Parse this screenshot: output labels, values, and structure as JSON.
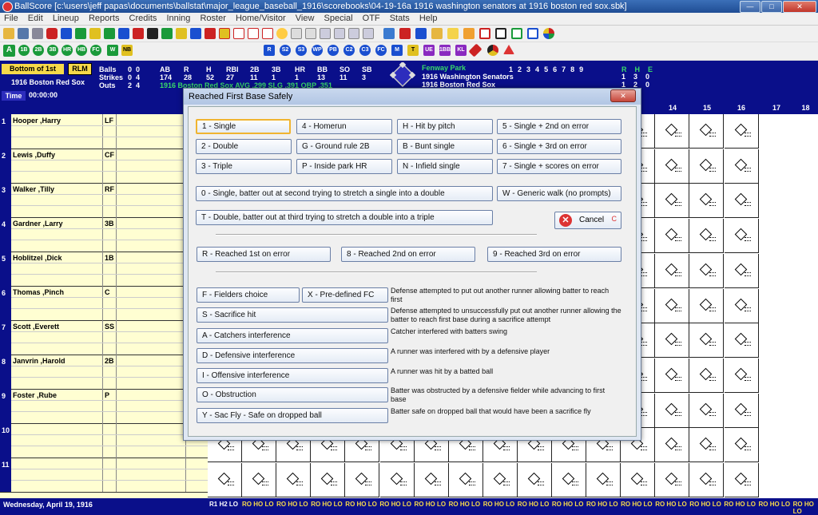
{
  "window": {
    "title": "BallScore   [c:\\users\\jeff papas\\documents\\ballstat\\major_league_baseball_1916\\scorebooks\\04-19-16a 1916 washington senators  at  1916 boston red sox.sbk]",
    "min": "—",
    "max": "□",
    "close": "✕"
  },
  "menu": [
    "File",
    "Edit",
    "Lineup",
    "Reports",
    "Credits",
    "Inning",
    "Roster",
    "Home/Visitor",
    "View",
    "Special",
    "OTF",
    "Stats",
    "Help"
  ],
  "toolbar2": [
    "A",
    "1B",
    "2B",
    "3B",
    "HR",
    "HB",
    "FC",
    "W",
    "NB",
    "R",
    "S2",
    "S3",
    "WP",
    "PB",
    "C2",
    "C3",
    "FC",
    "M",
    "T",
    "UE",
    "1BB",
    "KL"
  ],
  "scoreboard": {
    "inning": "Bottom of 1st",
    "rlm": "RLM",
    "team": "1916 Boston Red Sox",
    "time_label": "Time",
    "clock": "00:00:00",
    "counts": [
      {
        "label": "Balls",
        "a": "0",
        "b": "0"
      },
      {
        "label": "Strikes",
        "a": "0",
        "b": "4"
      },
      {
        "label": "Outs",
        "a": "2",
        "b": "4"
      }
    ],
    "stats_headers": [
      "AB",
      "R",
      "H",
      "RBI",
      "2B",
      "3B",
      "HR",
      "BB",
      "SO",
      "SB"
    ],
    "stats_values": [
      "174",
      "28",
      "52",
      "27",
      "11",
      "1",
      "1",
      "13",
      "11",
      "3"
    ],
    "stat_team_line": "1916 Boston Red Sox    AVG .299 SLG .391 OBP .351",
    "park": "Fenway Park",
    "line_teams": [
      "1916 Washington Senators",
      "1916 Boston Red Sox"
    ],
    "innings": [
      "1",
      "2",
      "3",
      "4",
      "5",
      "6",
      "7",
      "8",
      "9"
    ],
    "rhe_headers": [
      "R",
      "H",
      "E"
    ],
    "rhe": [
      [
        "1",
        "3",
        "0"
      ],
      [
        "1",
        "2",
        "0"
      ]
    ]
  },
  "columns": [
    "14",
    "15",
    "16",
    "17",
    "18"
  ],
  "lineup": [
    {
      "num": "1",
      "name": "Hooper ,Harry",
      "pos": "LF"
    },
    {
      "num": "2",
      "name": "Lewis ,Duffy",
      "pos": "CF"
    },
    {
      "num": "3",
      "name": "Walker ,Tilly",
      "pos": "RF"
    },
    {
      "num": "4",
      "name": "Gardner ,Larry",
      "pos": "3B"
    },
    {
      "num": "5",
      "name": "Hoblitzel ,Dick",
      "pos": "1B"
    },
    {
      "num": "6",
      "name": "Thomas ,Pinch",
      "pos": "C"
    },
    {
      "num": "7",
      "name": "Scott ,Everett",
      "pos": "SS"
    },
    {
      "num": "8",
      "name": "Janvrin ,Harold",
      "pos": "2B"
    },
    {
      "num": "9",
      "name": "Foster ,Rube",
      "pos": "P"
    },
    {
      "num": "10",
      "name": "",
      "pos": ""
    },
    {
      "num": "11",
      "name": "",
      "pos": ""
    }
  ],
  "footer": {
    "date": "Wednesday, April 19, 1916",
    "first": "R1 H2 LO",
    "rest": "RO HO LO"
  },
  "dialog": {
    "title": "Reached First Base Safely",
    "close": "✕",
    "hits": [
      "1 - Single",
      "4 - Homerun",
      "H - Hit by pitch",
      "5 - Single + 2nd on error",
      "2 - Double",
      "G - Ground rule 2B",
      "B - Bunt single",
      "6 - Single + 3rd on error",
      "3 - Triple",
      "P - Inside park HR",
      "N - Infield single",
      "7 - Single + scores on error"
    ],
    "stretch_single": "0 - Single, batter out at second trying to stretch a single into a double",
    "generic_walk": "W - Generic walk (no prompts)",
    "stretch_double": "T - Double, batter out at third trying to stretch a double into a triple",
    "cancel": "Cancel",
    "cancel_key": "C",
    "errors": [
      "R - Reached 1st on error",
      "8 - Reached 2nd on error",
      "9 - Reached 3rd on error"
    ],
    "fc": "F - Fielders choice",
    "pfc": "X - Pre-defined FC",
    "fc_desc": "Defense attempted to put out another runner allowing batter to reach first",
    "others": [
      {
        "label": "S - Sacrifice hit",
        "desc": "Defense attempted to unsuccessfully  put out another runner allowing the batter to reach first base during a sacrifice attempt"
      },
      {
        "label": "A - Catchers interference",
        "desc": "Catcher interfered with batters swing"
      },
      {
        "label": "D - Defensive interference",
        "desc": "A runner was interfered with by a defensive player"
      },
      {
        "label": "I - Offensive interference",
        "desc": "A runner was hit by a batted ball"
      },
      {
        "label": "O - Obstruction",
        "desc": "Batter was obstructed by a defensive fielder while advancing to first base"
      },
      {
        "label": "Y - Sac Fly - Safe on dropped ball",
        "desc": "Batter safe on dropped ball that would have been a sacrifice fly"
      }
    ]
  }
}
